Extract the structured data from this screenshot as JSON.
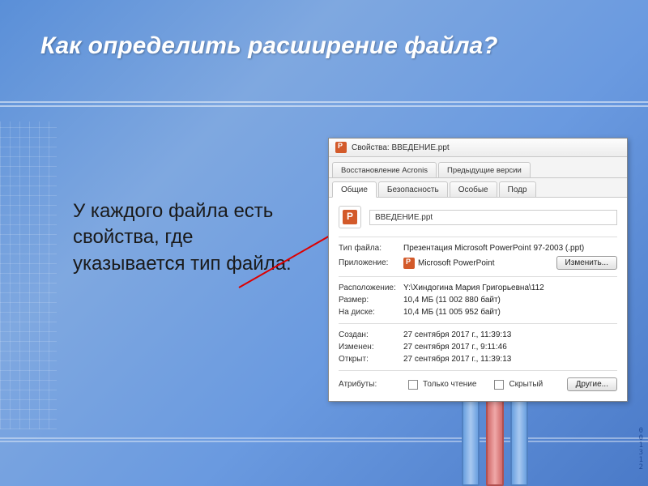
{
  "slide": {
    "title": "Как определить расширение файла?",
    "body": "У каждого файла есть свойства, где указывается тип файла:"
  },
  "dialog": {
    "title": "Свойства: ВВЕДЕНИЕ.ppt",
    "tabs_upper": {
      "acronis": "Восстановление Acronis",
      "prev": "Предыдущие версии"
    },
    "tabs_lower": {
      "general": "Общие",
      "security": "Безопасность",
      "special": "Особые",
      "details": "Подр"
    },
    "filename": "ВВЕДЕНИЕ.ppt",
    "labels": {
      "type": "Тип файла:",
      "app": "Приложение:",
      "location": "Расположение:",
      "size": "Размер:",
      "ondisk": "На диске:",
      "created": "Создан:",
      "modified": "Изменен:",
      "opened": "Открыт:",
      "attributes": "Атрибуты:",
      "readonly": "Только чтение",
      "hidden": "Скрытый"
    },
    "values": {
      "type": "Презентация Microsoft PowerPoint 97-2003 (.ppt)",
      "app": "Microsoft PowerPoint",
      "location": "Y:\\Хиндогина Мария Григорьевна\\112",
      "size": "10,4 МБ (11 002 880 байт)",
      "ondisk": "10,4 МБ (11 005 952 байт)",
      "created": "27 сентября 2017 г., 11:39:13",
      "modified": "27 сентября 2017 г., 9:11:46",
      "opened": "27 сентября 2017 г., 11:39:13"
    },
    "buttons": {
      "change": "Изменить...",
      "other": "Другие..."
    }
  },
  "decoration": {
    "digits": "0\n0\n1\n3\n1\n2"
  }
}
